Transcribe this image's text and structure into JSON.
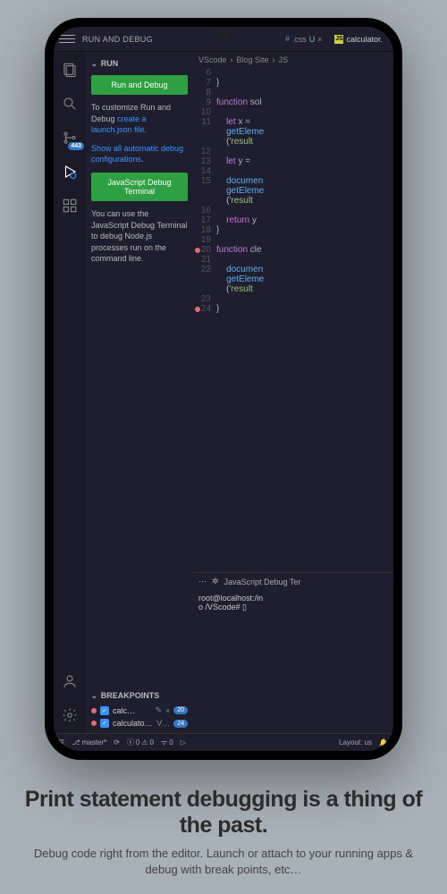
{
  "topbar": {
    "title": "RUN AND DEBUG",
    "tab1": {
      "name": ".css",
      "mod": "U",
      "close": "×"
    },
    "tab2": {
      "prefix": "JS",
      "name": "calculator."
    }
  },
  "activitybar": {
    "scm_count": "443"
  },
  "sidebar": {
    "run_hdr": "RUN",
    "btn_run": "Run and Debug",
    "text1_a": "To customize Run and Debug ",
    "text1_link": "create a launch.json file",
    "text1_dot": ".",
    "text2_link": "Show all automatic debug configurations",
    "text2_dot": ".",
    "btn_terminal": "JavaScript Debug Terminal",
    "text3": "You can use the JavaScript Debug Terminal to debug Node.js processes run on the command line.",
    "bp_hdr": "BREAKPOINTS",
    "bp1": {
      "name": "calc…",
      "badge": "20"
    },
    "bp2": {
      "name": "calculator.js",
      "ver": "V…",
      "badge": "24"
    }
  },
  "breadcrumb": {
    "a": "VScode",
    "b": "Blog Site",
    "c": "JS"
  },
  "code": {
    "lines": [
      {
        "n": "6"
      },
      {
        "n": "7",
        "t": "}"
      },
      {
        "n": "8"
      },
      {
        "n": "9",
        "t": "function sol"
      },
      {
        "n": "10"
      },
      {
        "n": "11",
        "t": "    let x = "
      },
      {
        "n": "",
        "t": "    getEleme"
      },
      {
        "n": "",
        "t": "    ('result"
      },
      {
        "n": "12"
      },
      {
        "n": "13",
        "t": "    let y = "
      },
      {
        "n": "14"
      },
      {
        "n": "15",
        "t": "    documen"
      },
      {
        "n": "",
        "t": "    getEleme"
      },
      {
        "n": "",
        "t": "    ('result"
      },
      {
        "n": "16"
      },
      {
        "n": "17",
        "t": "    return y"
      },
      {
        "n": "18",
        "t": "}"
      },
      {
        "n": "19"
      },
      {
        "n": "20",
        "t": "function cle",
        "bp": true
      },
      {
        "n": "21"
      },
      {
        "n": "22",
        "t": "    documen"
      },
      {
        "n": "",
        "t": "    getEleme"
      },
      {
        "n": "",
        "t": "    ('result"
      },
      {
        "n": "23"
      },
      {
        "n": "24",
        "t": "}",
        "bp": true
      }
    ]
  },
  "terminal": {
    "hdr": "JavaScript Debug Ter",
    "line1": "root@localhost:/in",
    "line2": "o /VScode# ▯"
  },
  "statusbar": {
    "branch": "master*",
    "errors": "0",
    "warnings": "0",
    "ports": "0",
    "layout": "Layout: us"
  },
  "caption": {
    "headline": "Print statement debugging is a thing of the past.",
    "sub": "Debug code right from the editor. Launch or attach to your running apps & debug with break points, etc…"
  }
}
